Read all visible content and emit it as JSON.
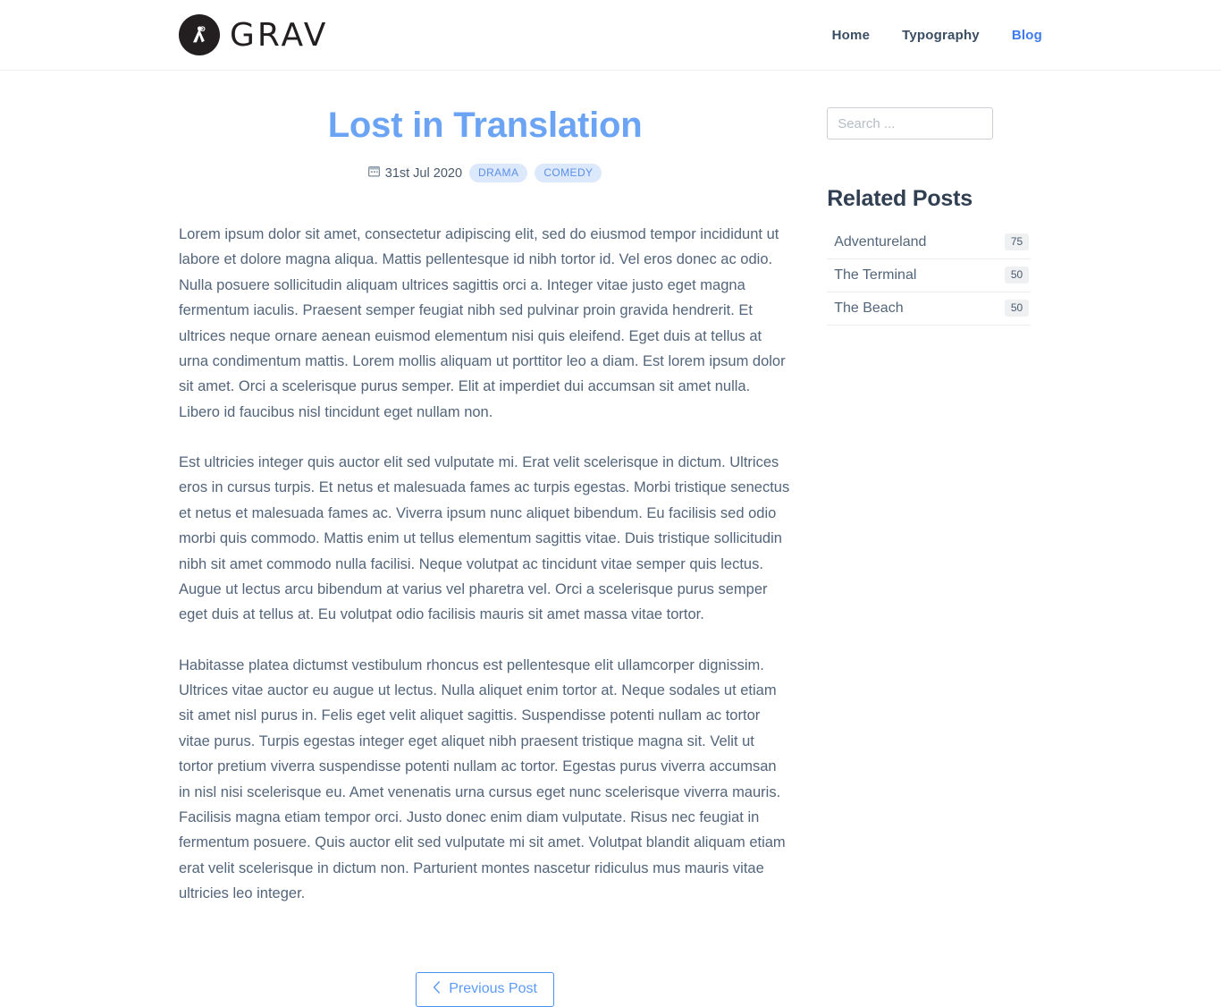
{
  "header": {
    "brand": {
      "name": "GRAV",
      "icon": "grav-compass-logo"
    },
    "nav": [
      {
        "label": "Home",
        "active": false
      },
      {
        "label": "Typography",
        "active": false
      },
      {
        "label": "Blog",
        "active": true
      }
    ]
  },
  "post": {
    "title": "Lost in Translation",
    "date": "31st Jul 2020",
    "date_icon": "calendar-icon",
    "tags": [
      "DRAMA",
      "COMEDY"
    ],
    "paragraphs": [
      "Lorem ipsum dolor sit amet, consectetur adipiscing elit, sed do eiusmod tempor incididunt ut labore et dolore magna aliqua. Mattis pellentesque id nibh tortor id. Vel eros donec ac odio. Nulla posuere sollicitudin aliquam ultrices sagittis orci a. Integer vitae justo eget magna fermentum iaculis. Praesent semper feugiat nibh sed pulvinar proin gravida hendrerit. Et ultrices neque ornare aenean euismod elementum nisi quis eleifend. Eget duis at tellus at urna condimentum mattis. Lorem mollis aliquam ut porttitor leo a diam. Est lorem ipsum dolor sit amet. Orci a scelerisque purus semper. Elit at imperdiet dui accumsan sit amet nulla. Libero id faucibus nisl tincidunt eget nullam non.",
      "Est ultricies integer quis auctor elit sed vulputate mi. Erat velit scelerisque in dictum. Ultrices eros in cursus turpis. Et netus et malesuada fames ac turpis egestas. Morbi tristique senectus et netus et malesuada fames ac. Viverra ipsum nunc aliquet bibendum. Eu facilisis sed odio morbi quis commodo. Mattis enim ut tellus elementum sagittis vitae. Duis tristique sollicitudin nibh sit amet commodo nulla facilisi. Neque volutpat ac tincidunt vitae semper quis lectus. Augue ut lectus arcu bibendum at varius vel pharetra vel. Orci a scelerisque purus semper eget duis at tellus at. Eu volutpat odio facilisis mauris sit amet massa vitae tortor.",
      "Habitasse platea dictumst vestibulum rhoncus est pellentesque elit ullamcorper dignissim. Ultrices vitae auctor eu augue ut lectus. Nulla aliquet enim tortor at. Neque sodales ut etiam sit amet nisl purus in. Felis eget velit aliquet sagittis. Suspendisse potenti nullam ac tortor vitae purus. Turpis egestas integer eget aliquet nibh praesent tristique magna sit. Velit ut tortor pretium viverra suspendisse potenti nullam ac tortor. Egestas purus viverra accumsan in nisl nisi scelerisque eu. Amet venenatis urna cursus eget nunc scelerisque viverra mauris. Facilisis magna etiam tempor orci. Justo donec enim diam vulputate. Risus nec feugiat in fermentum posuere. Quis auctor elit sed vulputate mi sit amet. Volutpat blandit aliquam etiam erat velit scelerisque in dictum non. Parturient montes nascetur ridiculus mus mauris vitae ultricies leo integer."
    ]
  },
  "pagination": {
    "previous_label": "Previous Post",
    "previous_icon": "chevron-left-icon"
  },
  "sidebar": {
    "search": {
      "value": "",
      "placeholder": "Search ...",
      "icon": "search-input"
    },
    "related_title": "Related Posts",
    "related_posts": [
      {
        "title": "Adventureland",
        "count": "75"
      },
      {
        "title": "The Terminal",
        "count": "50"
      },
      {
        "title": "The Beach",
        "count": "50"
      }
    ]
  },
  "colors": {
    "accent_blue": "#6ba3f5",
    "nav_active": "#3e7bf0",
    "text_body": "#53657a",
    "heading_dark": "#303f51",
    "tag_bg": "#dce8fb",
    "tag_text": "#5b8fe8",
    "badge_bg": "#eef0f2",
    "border_light": "#ebedef",
    "brand_black": "#231f20"
  }
}
